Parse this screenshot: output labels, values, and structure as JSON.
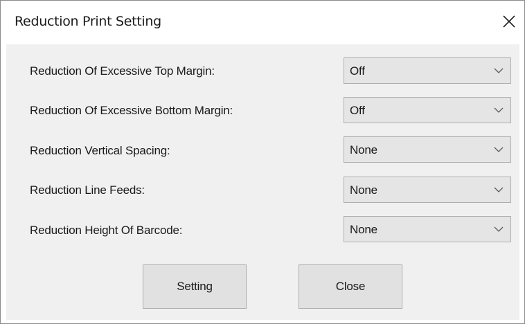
{
  "window": {
    "title": "Reduction Print Setting",
    "close_icon": "close-icon"
  },
  "settings": [
    {
      "label": "Reduction Of Excessive Top Margin:",
      "value": "Off"
    },
    {
      "label": "Reduction Of Excessive Bottom Margin:",
      "value": "Off"
    },
    {
      "label": "Reduction Vertical Spacing:",
      "value": "None"
    },
    {
      "label": "Reduction Line Feeds:",
      "value": "None"
    },
    {
      "label": "Reduction Height Of Barcode:",
      "value": "None"
    }
  ],
  "buttons": {
    "setting_label": "Setting",
    "close_label": "Close"
  },
  "colors": {
    "client_background": "#f0f0f0",
    "control_background": "#e5e5e5",
    "control_border": "#adadad"
  }
}
